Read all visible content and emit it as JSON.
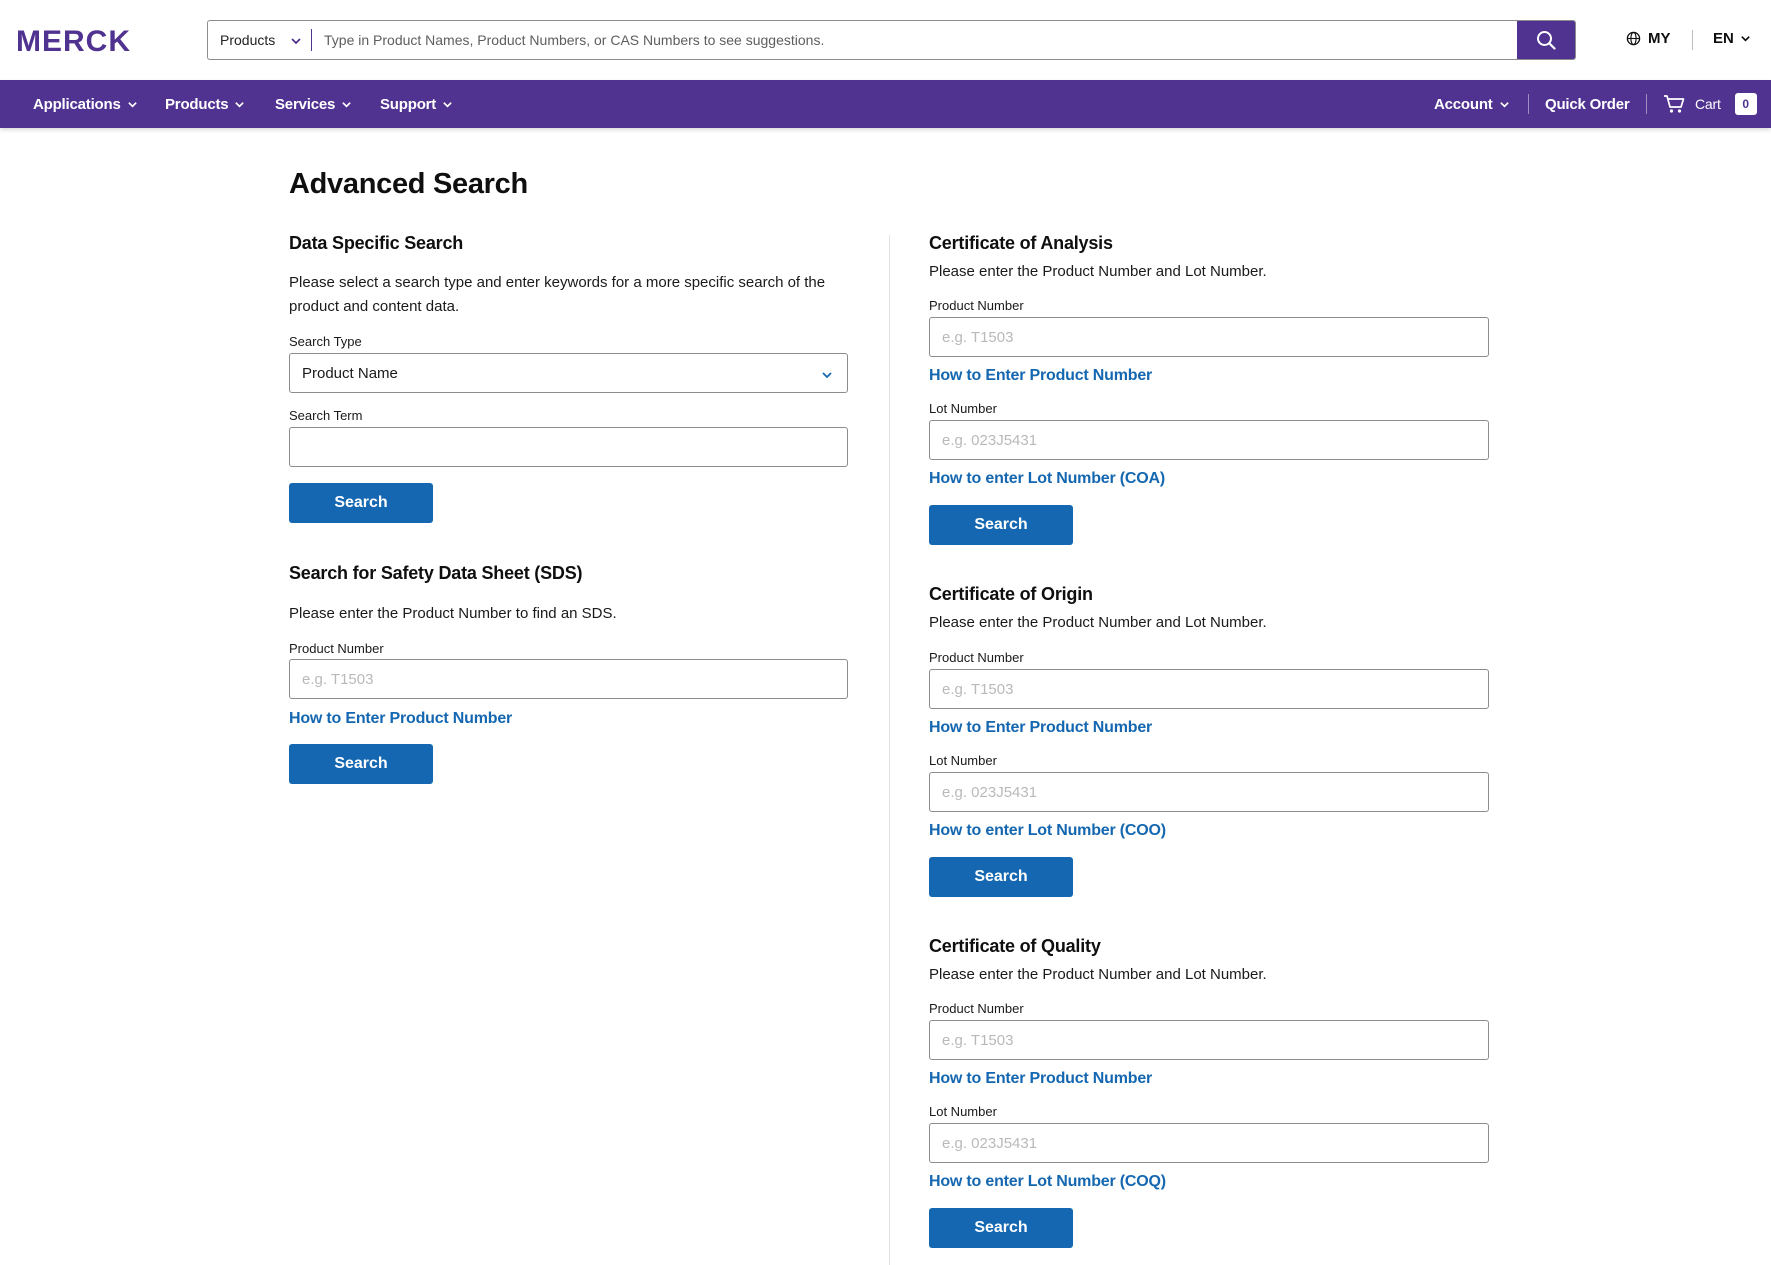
{
  "brand": {
    "logo_text": "MERCK",
    "primary_color": "#503291",
    "button_color": "#1467b0",
    "link_color": "#1467b0"
  },
  "header": {
    "search_scope": "Products",
    "search_placeholder": "Type in Product Names, Product Numbers, or CAS Numbers to see suggestions.",
    "country": "MY",
    "language": "EN"
  },
  "nav": {
    "items": [
      {
        "label": "Applications"
      },
      {
        "label": "Products"
      },
      {
        "label": "Services"
      },
      {
        "label": "Support"
      }
    ],
    "account": "Account",
    "quick_order": "Quick Order",
    "cart": "Cart",
    "cart_count": "0"
  },
  "page": {
    "title": "Advanced Search"
  },
  "data_specific": {
    "title": "Data Specific Search",
    "desc_line1": "Please select a search type and enter keywords for a more specific search of the",
    "desc_line2": "product and content data.",
    "search_type_label": "Search Type",
    "search_type_value": "Product Name",
    "search_term_label": "Search Term",
    "search_term_value": "",
    "button": "Search"
  },
  "sds": {
    "title": "Search for Safety Data Sheet (SDS)",
    "desc": "Please enter the Product Number to find an SDS.",
    "product_label": "Product Number",
    "product_placeholder": "e.g. T1503",
    "product_link": "How to Enter Product Number",
    "button": "Search"
  },
  "coa": {
    "title": "Certificate of Analysis",
    "desc": "Please enter the Product Number and Lot Number.",
    "product_label": "Product Number",
    "product_placeholder": "e.g. T1503",
    "product_link": "How to Enter Product Number",
    "lot_label": "Lot Number",
    "lot_placeholder": "e.g. 023J5431",
    "lot_link": "How to enter Lot Number (COA)",
    "button": "Search"
  },
  "coo": {
    "title": "Certificate of Origin",
    "desc": "Please enter the Product Number and Lot Number.",
    "product_label": "Product Number",
    "product_placeholder": "e.g. T1503",
    "product_link": "How to Enter Product Number",
    "lot_label": "Lot Number",
    "lot_placeholder": "e.g. 023J5431",
    "lot_link": "How to enter Lot Number (COO)",
    "button": "Search"
  },
  "coq": {
    "title": "Certificate of Quality",
    "desc": "Please enter the Product Number and Lot Number.",
    "product_label": "Product Number",
    "product_placeholder": "e.g. T1503",
    "product_link": "How to Enter Product Number",
    "lot_label": "Lot Number",
    "lot_placeholder": "e.g. 023J5431",
    "lot_link": "How to enter Lot Number (COQ)",
    "button": "Search"
  }
}
